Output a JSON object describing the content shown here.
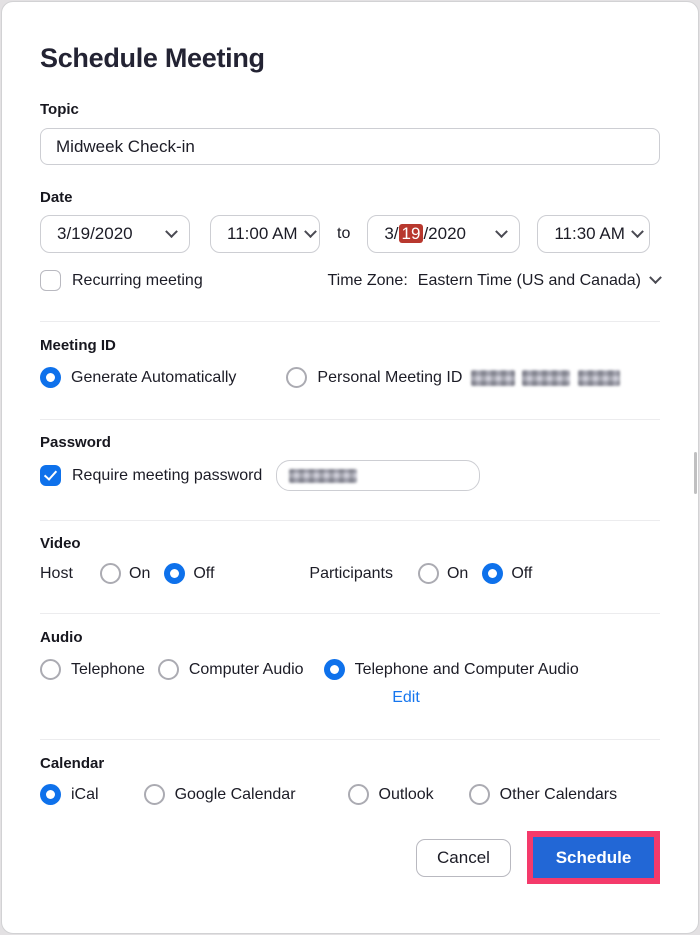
{
  "title": "Schedule Meeting",
  "topic": {
    "label": "Topic",
    "value": "Midweek Check-in"
  },
  "date": {
    "label": "Date",
    "start_date": "3/19/2020",
    "start_time": "11:00 AM",
    "to_label": "to",
    "end_date_prefix": "3/",
    "end_date_day": "19",
    "end_date_suffix": "/2020",
    "end_time": "11:30 AM",
    "recurring_label": "Recurring meeting",
    "recurring_checked": false,
    "timezone_label": "Time Zone:",
    "timezone_value": "Eastern Time (US and Canada)"
  },
  "meeting_id": {
    "label": "Meeting ID",
    "generate_label": "Generate Automatically",
    "personal_label": "Personal Meeting ID",
    "selected": "Generate Automatically",
    "personal_id_redacted": true
  },
  "password": {
    "label": "Password",
    "require_label": "Require meeting password",
    "require_checked": true,
    "value_redacted": true
  },
  "video": {
    "label": "Video",
    "host_label": "Host",
    "participants_label": "Participants",
    "on_label": "On",
    "off_label": "Off",
    "host_selected": "Off",
    "participants_selected": "Off"
  },
  "audio": {
    "label": "Audio",
    "options": [
      "Telephone",
      "Computer Audio",
      "Telephone and Computer Audio"
    ],
    "selected": "Telephone and Computer Audio",
    "edit_label": "Edit"
  },
  "calendar": {
    "label": "Calendar",
    "options": [
      "iCal",
      "Google Calendar",
      "Outlook",
      "Other Calendars"
    ],
    "selected": "iCal"
  },
  "buttons": {
    "cancel": "Cancel",
    "schedule": "Schedule"
  },
  "colors": {
    "accent_blue": "#0e71eb",
    "edit_link_blue": "#1676ee",
    "schedule_button_blue": "#2267d6",
    "annotation_pink": "#f43a6b",
    "selected_day_red": "#b8382e",
    "title_text": "#232333"
  }
}
